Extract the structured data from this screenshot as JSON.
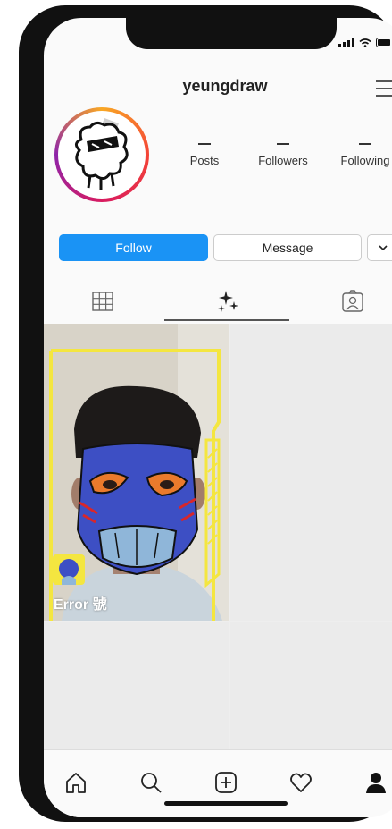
{
  "profile": {
    "username": "yeungdraw"
  },
  "stats": [
    {
      "value": "—",
      "label": "Posts"
    },
    {
      "value": "—",
      "label": "Followers"
    },
    {
      "value": "—",
      "label": "Following"
    }
  ],
  "actions": {
    "follow_label": "Follow",
    "message_label": "Message",
    "dropdown_glyph": "⌄"
  },
  "tabs": [
    {
      "name": "grid",
      "icon": "grid-icon"
    },
    {
      "name": "effects",
      "icon": "sparkles-icon",
      "active": true
    },
    {
      "name": "tagged",
      "icon": "tagged-person-icon"
    }
  ],
  "posts": [
    {
      "label": "Error 號"
    }
  ],
  "bottom_nav": [
    {
      "name": "home",
      "icon": "home-icon"
    },
    {
      "name": "search",
      "icon": "search-icon"
    },
    {
      "name": "create",
      "icon": "add-post-icon"
    },
    {
      "name": "activity",
      "icon": "heart-icon"
    },
    {
      "name": "profile",
      "icon": "profile-icon"
    }
  ],
  "colors": {
    "follow_button": "#1a93f5",
    "effect_frame": "#f4e640",
    "mask_blue": "#3d4fc4"
  }
}
